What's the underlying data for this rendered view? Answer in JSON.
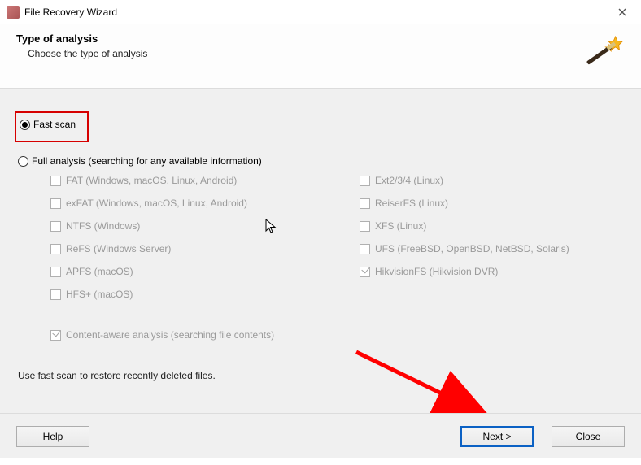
{
  "titlebar": {
    "title": "File Recovery Wizard"
  },
  "header": {
    "title": "Type of analysis",
    "subtitle": "Choose the type of analysis"
  },
  "options": {
    "fast_scan": {
      "label": "Fast scan",
      "selected": true
    },
    "full_analysis": {
      "label": "Full analysis (searching for any available information)",
      "selected": false,
      "left": [
        "FAT (Windows, macOS, Linux, Android)",
        "exFAT (Windows, macOS, Linux, Android)",
        "NTFS (Windows)",
        "ReFS (Windows Server)",
        "APFS (macOS)",
        "HFS+ (macOS)"
      ],
      "right": [
        {
          "label": "Ext2/3/4 (Linux)",
          "checked": false
        },
        {
          "label": "ReiserFS (Linux)",
          "checked": false
        },
        {
          "label": "XFS (Linux)",
          "checked": false
        },
        {
          "label": "UFS (FreeBSD, OpenBSD, NetBSD, Solaris)",
          "checked": false
        },
        {
          "label": "HikvisionFS (Hikvision DVR)",
          "checked": true
        }
      ],
      "content_aware": {
        "label": "Content-aware analysis (searching file contents)",
        "checked": true
      }
    }
  },
  "hint": "Use fast scan to restore recently deleted files.",
  "buttons": {
    "help": "Help",
    "next": "Next >",
    "close": "Close"
  }
}
